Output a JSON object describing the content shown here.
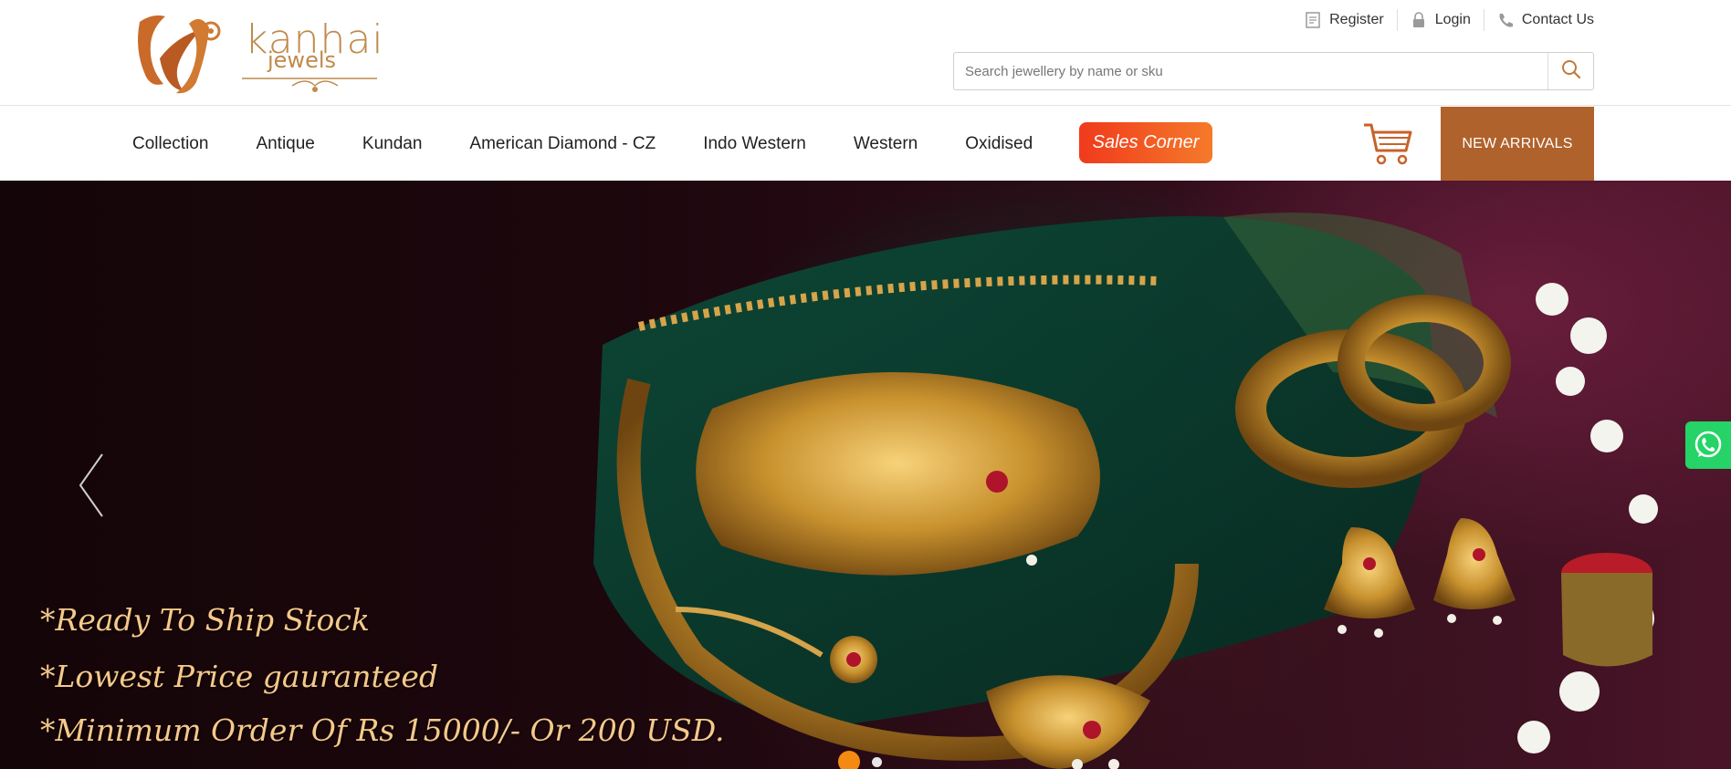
{
  "brand": {
    "logo_word": "kanhai",
    "logo_sub": "jewels",
    "accent_color": "#b0622c",
    "logo_color": "#c08a4c"
  },
  "top_links": [
    {
      "label": "Register",
      "icon": "register-form-icon"
    },
    {
      "label": "Login",
      "icon": "lock-icon"
    },
    {
      "label": "Contact Us",
      "icon": "phone-icon"
    }
  ],
  "search": {
    "placeholder": "Search jewellery by name or sku",
    "value": "",
    "button_icon": "search-icon"
  },
  "nav": {
    "items": [
      {
        "label": "Collection"
      },
      {
        "label": "Antique"
      },
      {
        "label": "Kundan"
      },
      {
        "label": "American Diamond - CZ"
      },
      {
        "label": "Indo Western"
      },
      {
        "label": "Western"
      },
      {
        "label": "Oxidised"
      }
    ],
    "sales_corner": "Sales Corner",
    "cart_icon": "shopping-cart-icon",
    "new_arrivals": "NEW ARRIVALS"
  },
  "hero": {
    "lines": [
      "*Ready To Ship Stock",
      "*Lowest Price gauranteed",
      "*Minimum Order Of Rs 15000/- Or 200 USD."
    ],
    "slide_count": 2,
    "active_slide": 1,
    "prev_icon": "chevron-left-icon"
  },
  "whatsapp": {
    "icon": "whatsapp-icon",
    "color": "#25d366"
  }
}
